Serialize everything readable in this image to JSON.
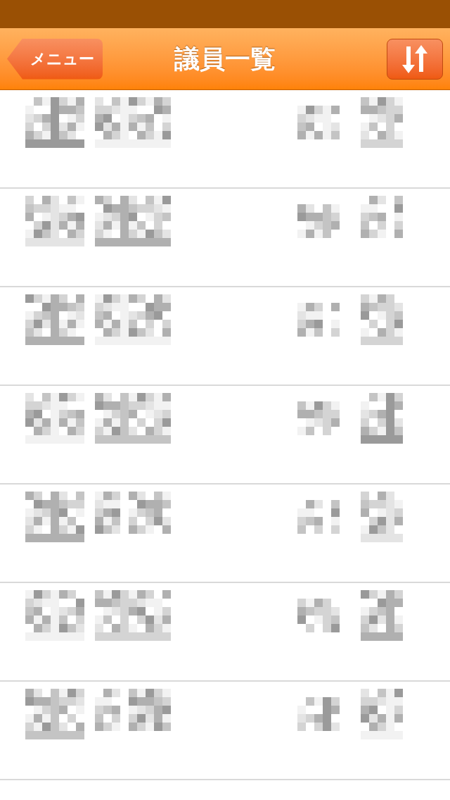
{
  "nav_bar": {
    "back_button": "メニュー",
    "title": "議員一覧"
  },
  "rows": [
    {
      "kind": "pixelated"
    },
    {
      "kind": "pixelated"
    },
    {
      "kind": "pixelated"
    },
    {
      "kind": "pixelated"
    },
    {
      "kind": "pixelated"
    },
    {
      "kind": "pixelated"
    },
    {
      "kind": "pixelated"
    }
  ]
}
